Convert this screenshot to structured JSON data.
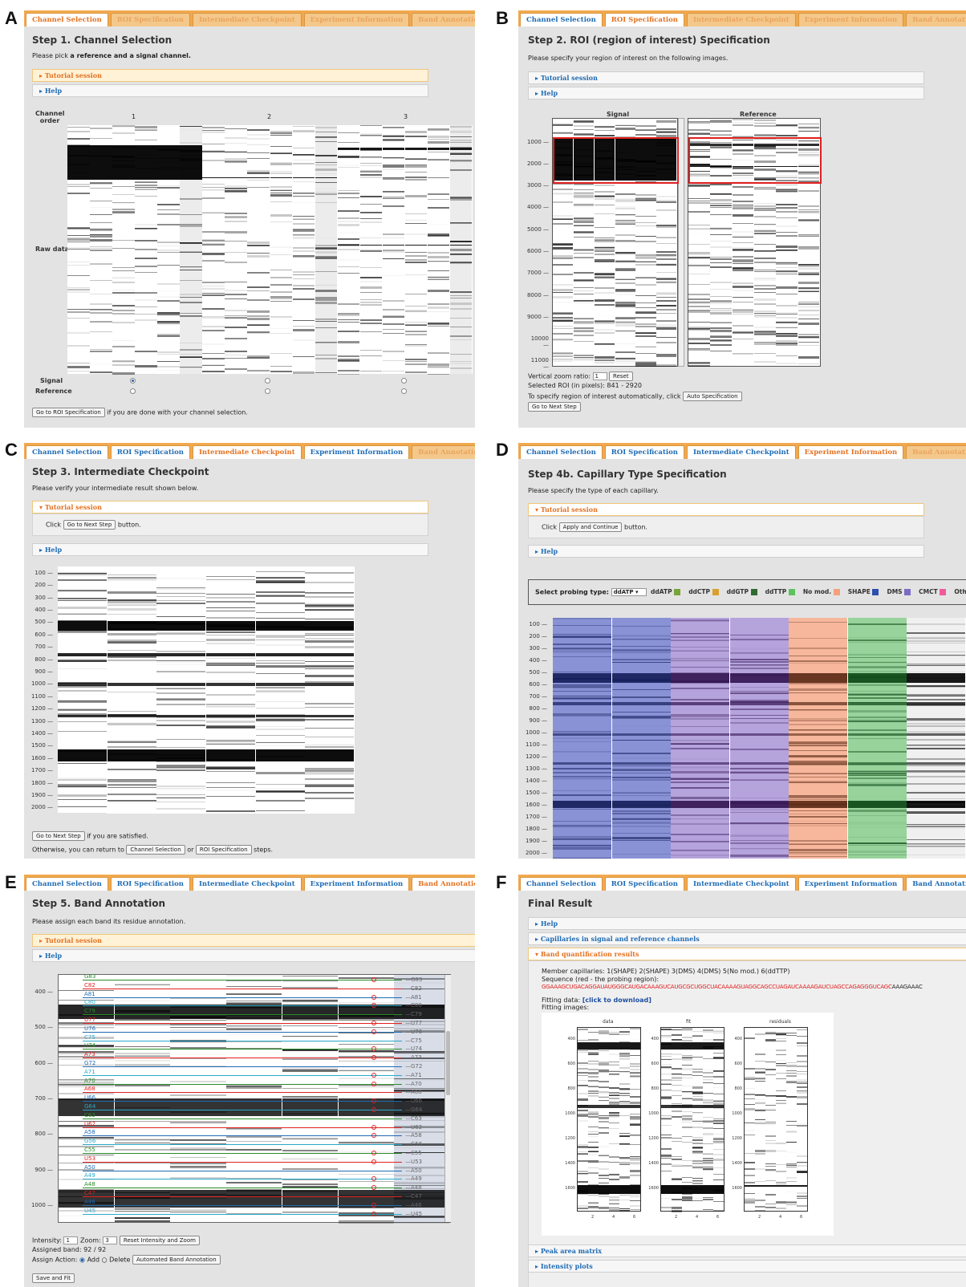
{
  "tab_labels": [
    "Channel Selection",
    "ROI Specification",
    "Intermediate Checkpoint",
    "Experiment Information",
    "Band Annotation",
    "Final Result"
  ],
  "panels": {
    "A": {
      "letter": "A",
      "tab_states": [
        "active",
        "disabled",
        "disabled",
        "disabled",
        "disabled",
        "disabled"
      ],
      "title": "Step 1. Channel Selection",
      "desc_pre": "Please pick ",
      "desc_bold": "a reference and a signal channel.",
      "tutorial": "Tutorial session",
      "help": "Help",
      "channel_order": "Channel order",
      "channels": [
        "1",
        "2",
        "3"
      ],
      "raw_data": "Raw data",
      "signal": "Signal",
      "reference": "Reference",
      "goto_btn": "Go to ROI Specification",
      "goto_text": "if you are done with your channel selection."
    },
    "B": {
      "letter": "B",
      "tab_states": [
        "normal",
        "active",
        "disabled",
        "disabled",
        "disabled",
        "disabled"
      ],
      "title": "Step 2. ROI (region of interest) Specification",
      "desc": "Please specify your region of interest on the following images.",
      "tutorial": "Tutorial session",
      "help": "Help",
      "signal_label": "Signal",
      "reference_label": "Reference",
      "yticks": [
        "1000",
        "2000",
        "3000",
        "4000",
        "5000",
        "6000",
        "7000",
        "8000",
        "9000",
        "10000",
        "11000"
      ],
      "zoom_label": "Vertical zoom ratio:",
      "zoom_value": "1",
      "reset_btn": "Reset",
      "selected_roi": "Selected ROI (in pixels): 841 - 2920",
      "auto_text": "To specify region of interest automatically, click",
      "auto_btn": "Auto Specification",
      "next_btn": "Go to Next Step"
    },
    "C": {
      "letter": "C",
      "tab_states": [
        "normal",
        "normal",
        "active",
        "normal",
        "disabled",
        "disabled"
      ],
      "title": "Step 3. Intermediate Checkpoint",
      "desc": "Please verify your intermediate result shown below.",
      "tutorial": "Tutorial session",
      "click": "Click",
      "next_btn": "Go to Next Step",
      "button_word": "button.",
      "help": "Help",
      "yticks": [
        "100",
        "200",
        "300",
        "400",
        "500",
        "600",
        "700",
        "800",
        "900",
        "1000",
        "1100",
        "1200",
        "1300",
        "1400",
        "1500",
        "1600",
        "1700",
        "1800",
        "1900",
        "2000"
      ],
      "next_btn2": "Go to Next Step",
      "satisfied": "if you are satisfied.",
      "otherwise": "Otherwise, you can return to",
      "channel_btn": "Channel Selection",
      "or": "or",
      "roi_btn": "ROI Specification",
      "steps": "steps."
    },
    "D": {
      "letter": "D",
      "tab_states": [
        "normal",
        "normal",
        "normal",
        "active",
        "disabled",
        "disabled"
      ],
      "title": "Step 4b. Capillary Type Specification",
      "desc": "Please specify the type of each capillary.",
      "tutorial": "Tutorial session",
      "click": "Click",
      "apply_btn": "Apply and Continue",
      "button_word": "button.",
      "help": "Help",
      "probing_label": "Select probing type:",
      "probing_value": "ddATP",
      "legend": [
        {
          "name": "ddATP",
          "color": "#7aa33a"
        },
        {
          "name": "ddCTP",
          "color": "#d9a02e"
        },
        {
          "name": "ddGTP",
          "color": "#2f6b2f"
        },
        {
          "name": "ddTTP",
          "color": "#5ec25e"
        },
        {
          "name": "No mod.",
          "color": "#f4a07a"
        },
        {
          "name": "SHAPE",
          "color": "#2c4fb0"
        },
        {
          "name": "DMS",
          "color": "#7c6cc8"
        },
        {
          "name": "CMCT",
          "color": "#f05a9a"
        },
        {
          "name": "Oth",
          "color": "#aaaaaa"
        }
      ],
      "yticks": [
        "100",
        "200",
        "300",
        "400",
        "500",
        "600",
        "700",
        "800",
        "900",
        "1000",
        "1100",
        "1200",
        "1300",
        "1400",
        "1500",
        "1600",
        "1700",
        "1800",
        "1900",
        "2000"
      ]
    },
    "E": {
      "letter": "E",
      "tab_states": [
        "normal",
        "normal",
        "normal",
        "normal",
        "active",
        "disabled"
      ],
      "title": "Step 5. Band Annotation",
      "desc": "Please assign each band its residue annotation.",
      "tutorial": "Tutorial session",
      "help": "Help",
      "yticks": [
        "400",
        "500",
        "600",
        "700",
        "800",
        "900",
        "1000"
      ],
      "left_labels": [
        "G83",
        "C82",
        "A81",
        "C80",
        "C79",
        "U77",
        "U76",
        "C75",
        "U74",
        "A73",
        "G72",
        "A71",
        "A70",
        "A68",
        "U66",
        "G64",
        "C63",
        "U62",
        "A58",
        "G56",
        "C55",
        "U53",
        "A50",
        "A49",
        "A48",
        "C47",
        "A46",
        "U45"
      ],
      "intensity_label": "Intensity:",
      "intensity_value": "1",
      "zoom_label": "Zoom:",
      "zoom_value": "3",
      "reset_btn": "Reset Intensity and Zoom",
      "assigned": "Assigned band: 92 / 92",
      "assign_action": "Assign Action:",
      "add": "Add",
      "delete": "Delete",
      "auto_btn": "Automated Band Annotation",
      "save_btn": "Save and Fit"
    },
    "F": {
      "letter": "F",
      "tab_states": [
        "normal",
        "normal",
        "normal",
        "normal",
        "normal",
        "active"
      ],
      "title": "Final Result",
      "help": "Help",
      "capillaries": "Capillaries in signal and reference channels",
      "band_quant": "Band quantification results",
      "member": "Member capillaries: 1(SHAPE) 2(SHAPE) 3(DMS) 4(DMS) 5(No mod.) 6(ddTTP)",
      "sequence_label": "Sequence (red - the probing region):",
      "sequence_red": "GGAAAGCUGACAGGAUAUGGGCAUGACAAAGUCAUGCGCUGGCUACAAAAGUAGGCAGCCUAGAUCAAAAGAUCUAGCCAGAGGGUCAGC",
      "sequence_black": "AAAGAAAC",
      "fitting_data": "Fitting data:",
      "download": "[click to download]",
      "fitting_images": "Fitting images:",
      "plot_titles": [
        "data",
        "fit",
        "residuals"
      ],
      "plot_yticks": [
        "400",
        "600",
        "800",
        "1000",
        "1200",
        "1400",
        "1600"
      ],
      "plot_xticks": [
        "2",
        "4",
        "6"
      ],
      "peak": "Peak area matrix",
      "intensity_plots": "Intensity plots"
    }
  }
}
